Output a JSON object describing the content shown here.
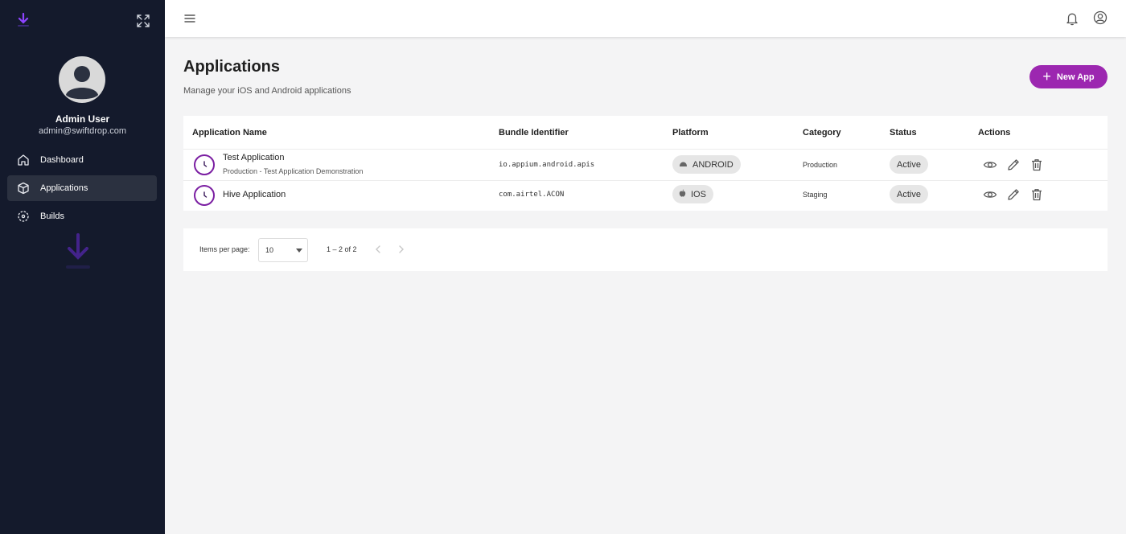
{
  "sidebar": {
    "user_name": "Admin User",
    "user_email": "admin@swiftdrop.com",
    "nav": [
      {
        "label": "Dashboard",
        "icon": "home-icon",
        "active": false
      },
      {
        "label": "Applications",
        "icon": "cube-icon",
        "active": true
      },
      {
        "label": "Builds",
        "icon": "builds-icon",
        "active": false
      }
    ]
  },
  "page": {
    "title": "Applications",
    "subtitle": "Manage your iOS and Android applications",
    "new_app_label": "New App"
  },
  "table": {
    "headers": {
      "name": "Application Name",
      "bundle": "Bundle Identifier",
      "platform": "Platform",
      "category": "Category",
      "status": "Status",
      "actions": "Actions"
    },
    "rows": [
      {
        "name": "Test Application",
        "description": "Production - Test Application Demonstration",
        "bundle": "io.appium.android.apis",
        "platform": "ANDROID",
        "platform_icon": "android-icon",
        "category": "Production",
        "status": "Active"
      },
      {
        "name": "Hive Application",
        "description": "",
        "bundle": "com.airtel.ACON",
        "platform": "IOS",
        "platform_icon": "apple-icon",
        "category": "Staging",
        "status": "Active"
      }
    ]
  },
  "pagination": {
    "items_per_page_label": "Items per page:",
    "items_per_page": "10",
    "range": "1 – 2 of 2"
  },
  "colors": {
    "sidebar_bg": "#141a2c",
    "accent": "#9c27b0",
    "app_icon_border": "#7b1fa2"
  }
}
